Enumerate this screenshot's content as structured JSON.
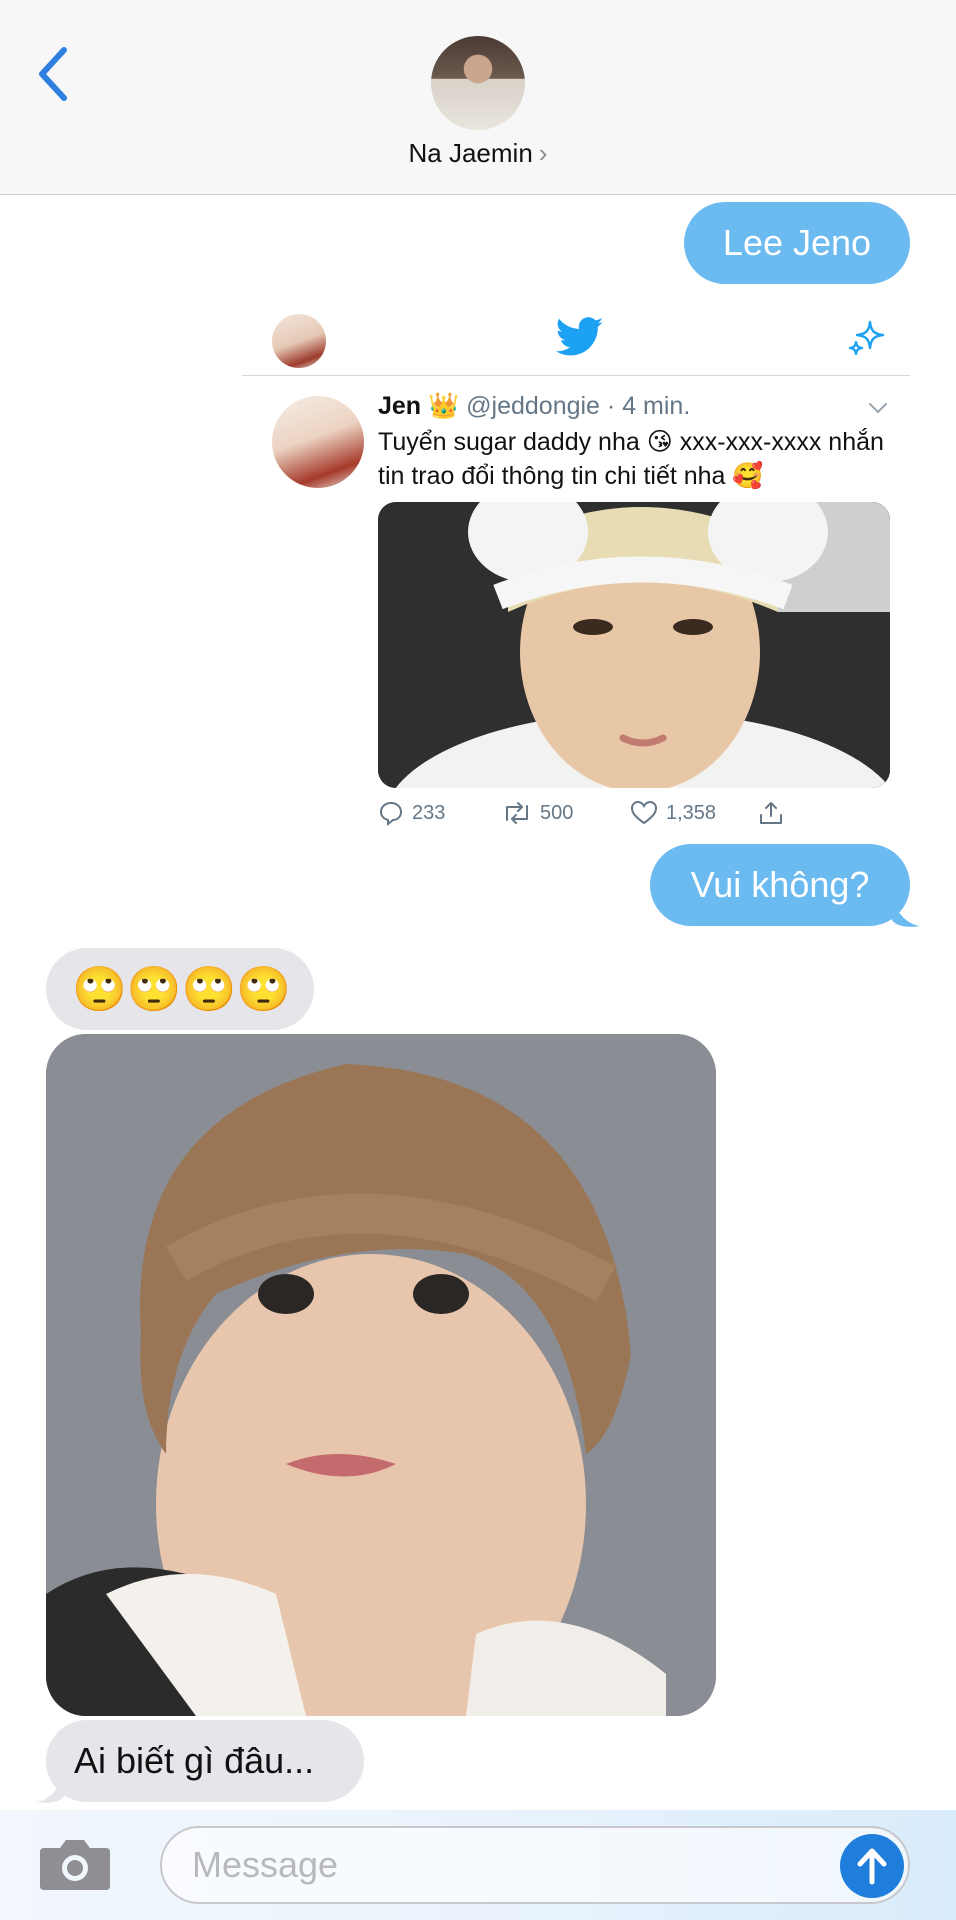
{
  "header": {
    "contact_name": "Na Jaemin",
    "chevron": "›"
  },
  "messages": {
    "out_1": "Lee Jeno",
    "out_2": "Vui không?",
    "in_emoji": "🙄🙄🙄🙄",
    "in_text": "Ai biết gì đâu..."
  },
  "tweet": {
    "name": "Jen",
    "crown": "👑",
    "handle": "@jeddongie",
    "time": "· 4 min.",
    "text": "Tuyển sugar daddy nha 😘 xxx-xxx-xxxx nhắn tin trao đổi thông tin chi tiết nha 🥰",
    "replies": "233",
    "retweets": "500",
    "likes": "1,358"
  },
  "composer": {
    "placeholder": "Message"
  },
  "colors": {
    "outgoing_bubble": "#6cbbf0",
    "incoming_bubble": "#e5e5ea",
    "ios_blue": "#1f7ddc",
    "twitter_blue": "#1da1f2"
  },
  "icons": [
    "back-chevron-icon",
    "twitter-bird-icon",
    "sparkle-icon",
    "caret-down-icon",
    "reply-icon",
    "retweet-icon",
    "like-icon",
    "share-icon",
    "camera-icon",
    "send-arrow-icon"
  ]
}
